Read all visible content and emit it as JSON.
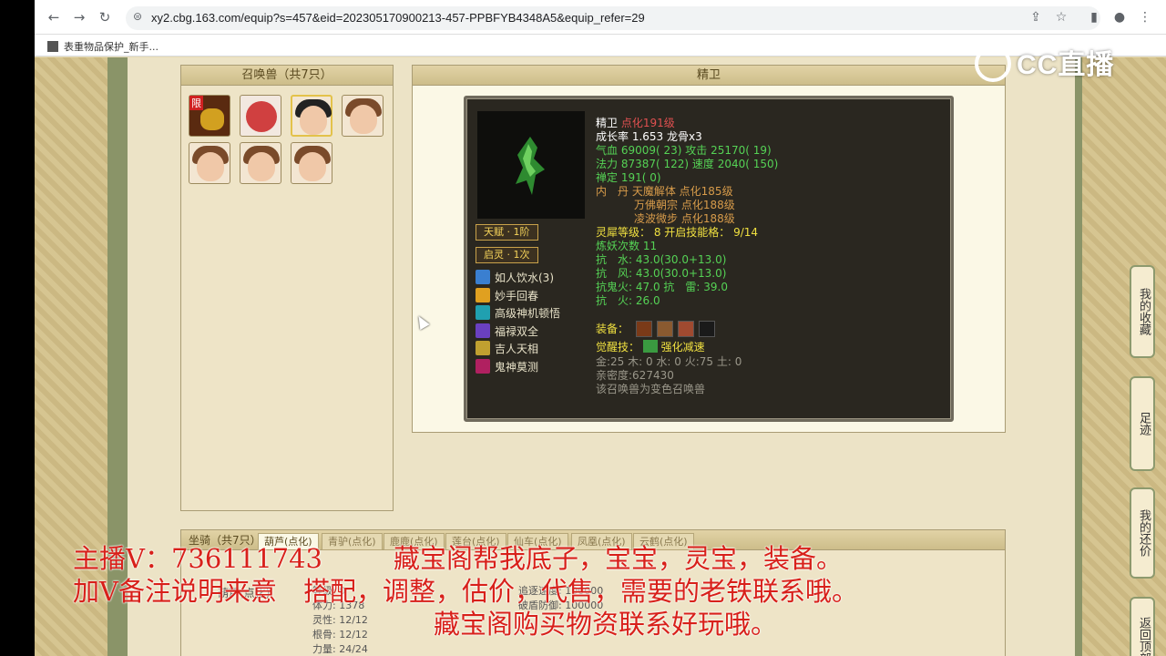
{
  "browser": {
    "url": "xy2.cbg.163.com/equip?s=457&eid=202305170900213-457-PPBFYB4348A5&equip_refer=29",
    "bookmark": "表重物品保护_新手..."
  },
  "pet_list": {
    "title": "召唤兽（共7只）",
    "limit_badge": "限"
  },
  "detail": {
    "title": "精卫",
    "name": "精卫",
    "dianhua": "点化191级",
    "growth": "成长率 1.653 龙骨x3",
    "hp": "气血 69009( 23)",
    "atk": "攻击 25170( 19)",
    "mp": "法力 87387( 122)",
    "spd": "速度 2040( 150)",
    "chan": "禅定 191( 0)",
    "neidan_label": "内　丹",
    "neidan": [
      "天魔解体 点化185级",
      "万佛朝宗 点化188级",
      "凌波微步 点化188级"
    ],
    "lingxi": "灵犀等级： 8 开启技能格： 9/14",
    "lianyao": "炼妖次数 11",
    "resists": [
      "抗　水: 43.0(30.0+13.0)",
      "抗　风: 43.0(30.0+13.0)",
      "抗鬼火: 47.0 抗　雷: 39.0",
      "抗　火: 26.0"
    ],
    "equip_label": "装备：",
    "awaken_label": "觉醒技：",
    "awaken": "强化减速",
    "five_elements": "金:25 木: 0 水: 0 火:75 土: 0",
    "intimacy": "亲密度:627430",
    "variant": "该召唤兽为变色召唤兽",
    "tianfu": "天赋 · 1阶",
    "qiling": "启灵 · 1次",
    "skills": [
      "如人饮水(3)",
      "妙手回春",
      "高级神机顿悟",
      "福禄双全",
      "吉人天相",
      "鬼神莫测"
    ],
    "skill_colors": [
      "#3a7fd0",
      "#e0a020",
      "#20a0b0",
      "#6a40c0",
      "#c0a030",
      "#b02060"
    ]
  },
  "mount": {
    "title": "坐骑（共7只）",
    "tabs": [
      "葫芦(点化)",
      "青驴(点化)",
      "鹿鹿(点化)",
      "莲台(点化)",
      "仙车(点化)",
      "凤凰(点化)",
      "云鹤(点化)"
    ],
    "name": "葫芦(点化)",
    "stats": [
      "等级: 0",
      "体力: 1378",
      "灵性: 12/12",
      "根骨: 12/12",
      "力量: 24/24"
    ],
    "stats2": [
      "追逐速度: 100000",
      "破盾防御: 100000"
    ]
  },
  "sidebar": [
    "我的收藏",
    "足迹",
    "我的还价",
    "返回顶部"
  ],
  "watermark": "CC直播",
  "overlay": {
    "line1a": "主播V：736111743",
    "line1b": "藏宝阁帮我底子，宝宝，灵宝，装备。",
    "line2": "加V备注说明来意　搭配，调整，估价，代售，需要的老铁联系哦。",
    "line3": "藏宝阁购买物资联系好玩哦。"
  }
}
